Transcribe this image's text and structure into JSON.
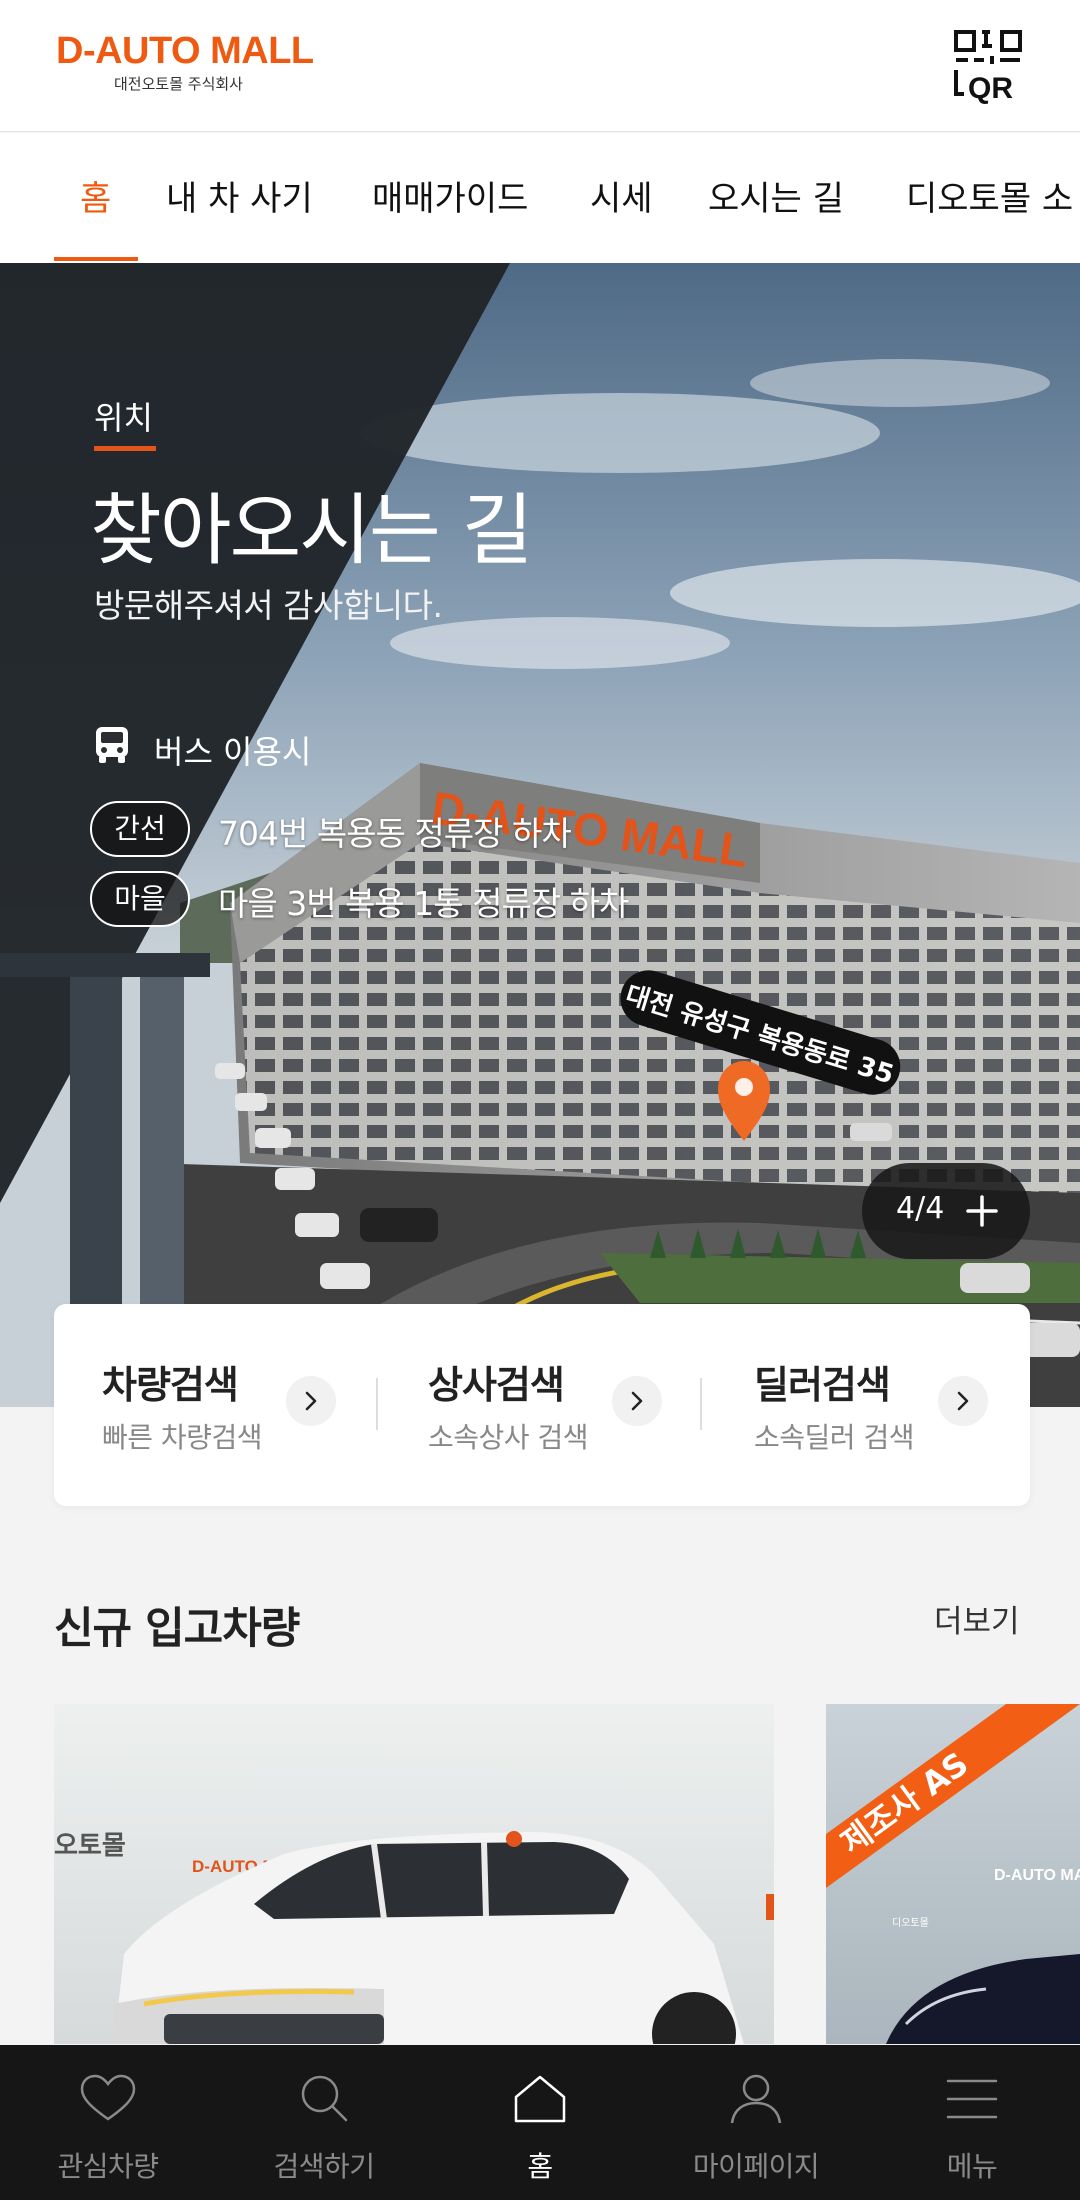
{
  "header": {
    "logo_main": "D-AUTO MALL",
    "logo_sub": "대전오토몰 주식회사",
    "qr_icon": "qr-code-icon"
  },
  "nav": {
    "items": [
      {
        "label": "홈",
        "active": true
      },
      {
        "label": "내 차 사기",
        "active": false
      },
      {
        "label": "매매가이드",
        "active": false
      },
      {
        "label": "시세",
        "active": false
      },
      {
        "label": "오시는 길",
        "active": false
      },
      {
        "label": "디오토몰 소",
        "active": false
      }
    ]
  },
  "hero": {
    "eyebrow": "위치",
    "title": "찾아오시는 길",
    "subtitle": "방문해주셔서 감사합니다.",
    "bus_label": "버스 이용시",
    "routes": [
      {
        "badge": "간선",
        "text": "704번 복용동 정류장 하차"
      },
      {
        "badge": "마을",
        "text": "마을 3번 복용 1통 정류장 하차"
      }
    ],
    "building_sign": "D-AUTO MALL",
    "address_tag": "대전 유성구 복용동로 35",
    "pager": "4/4",
    "accent": "#e2541a"
  },
  "search": {
    "items": [
      {
        "title": "차량검색",
        "sub": "빠른 차량검색"
      },
      {
        "title": "상사검색",
        "sub": "소속상사 검색"
      },
      {
        "title": "딜러검색",
        "sub": "소속딜러 검색"
      }
    ]
  },
  "new_arrivals": {
    "title": "신규 입고차량",
    "more": "더보기",
    "cards": [
      {
        "wall_brand": "D-AUTO MALL",
        "wall_text": "오토몰"
      },
      {
        "ribbon": "제조사 AS",
        "wall_brand": "D-AUTO MA",
        "wall_text": "디오토몰"
      }
    ]
  },
  "tabbar": {
    "items": [
      {
        "label": "관심차량",
        "icon": "heart-icon",
        "active": false
      },
      {
        "label": "검색하기",
        "icon": "search-icon",
        "active": false
      },
      {
        "label": "홈",
        "icon": "home-icon",
        "active": true
      },
      {
        "label": "마이페이지",
        "icon": "person-icon",
        "active": false
      },
      {
        "label": "메뉴",
        "icon": "menu-icon",
        "active": false
      }
    ]
  }
}
